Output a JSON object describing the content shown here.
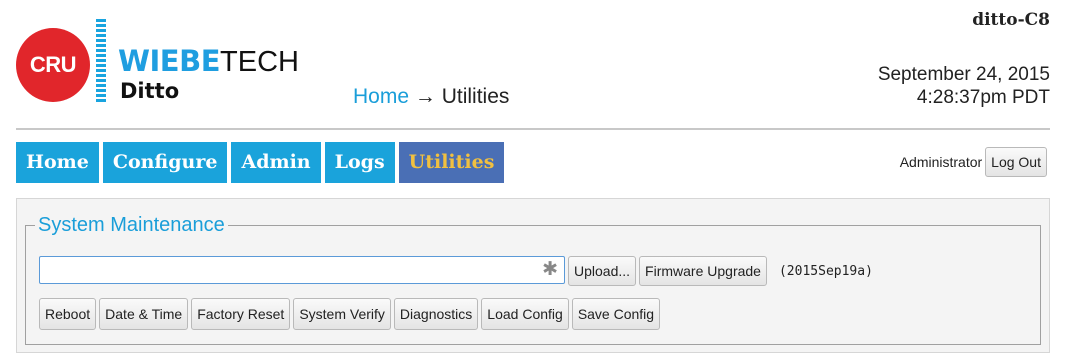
{
  "header": {
    "hostname": "ditto-C8",
    "logo": {
      "circle_text": "CRU",
      "brand_bold": "WIEBE",
      "brand_light": "TECH",
      "product": "Ditto"
    },
    "breadcrumb": {
      "home": "Home",
      "separator": "→",
      "current": "Utilities"
    },
    "date": "September 24, 2015",
    "time": "4:28:37pm PDT"
  },
  "nav": {
    "tabs": [
      {
        "label": "Home",
        "active": false
      },
      {
        "label": "Configure",
        "active": false
      },
      {
        "label": "Admin",
        "active": false
      },
      {
        "label": "Logs",
        "active": false
      },
      {
        "label": "Utilities",
        "active": true
      }
    ]
  },
  "user": {
    "name": "Administrator",
    "logout_label": "Log Out"
  },
  "maintenance": {
    "legend": "System Maintenance",
    "file_input": {
      "value": "",
      "placeholder": ""
    },
    "clear_icon": "✱",
    "upload_label": "Upload...",
    "firmware_upgrade_label": "Firmware Upgrade",
    "firmware_version": "(2015Sep19a)",
    "buttons": [
      {
        "label": "Reboot"
      },
      {
        "label": "Date & Time"
      },
      {
        "label": "Factory Reset"
      },
      {
        "label": "System Verify"
      },
      {
        "label": "Diagnostics"
      },
      {
        "label": "Load Config"
      },
      {
        "label": "Save Config"
      }
    ]
  },
  "colors": {
    "nav_tab": "#1aa3db",
    "nav_tab_active": "#4a6fb5",
    "nav_active_text": "#f1c040",
    "accent": "#1a9ed9",
    "logo_red": "#e1262b"
  }
}
